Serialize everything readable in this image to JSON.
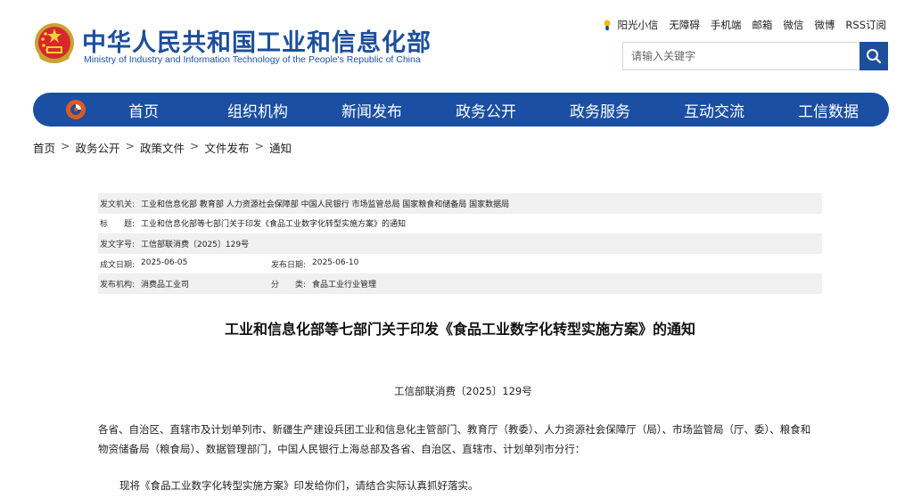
{
  "header": {
    "title_cn": "中华人民共和国工业和信息化部",
    "title_en": "Ministry of Industry and Information Technology of the People's Republic of China",
    "brand_color": "#1d4f9c",
    "top_links": [
      "阳光小信",
      "无障碍",
      "手机端",
      "邮箱",
      "微信",
      "微博",
      "RSS订阅"
    ],
    "search_placeholder": "请输入关键字"
  },
  "nav": {
    "color": "#1a4fa3",
    "items": [
      "首页",
      "组织机构",
      "新闻发布",
      "政务公开",
      "政务服务",
      "互动交流",
      "工信数据"
    ]
  },
  "breadcrumb": [
    "首页",
    "政务公开",
    "政策文件",
    "文件发布",
    "通知"
  ],
  "meta": {
    "issuer_label": "发文机关:",
    "issuer": "工业和信息化部 教育部 人力资源社会保障部 中国人民银行 市场监管总局 国家粮食和储备局 国家数据局",
    "title_label": "标　　题:",
    "title": "工业和信息化部等七部门关于印发《食品工业数字化转型实施方案》的通知",
    "doc_no_label": "发文字号:",
    "doc_no": "工信部联消费〔2025〕129号",
    "created_label": "成文日期:",
    "created": "2025-06-05",
    "published_label": "发布日期:",
    "published": "2025-06-10",
    "org_label": "发布机构:",
    "org": "消费品工业司",
    "category_label": "分　　类:",
    "category": "食品工业行业管理"
  },
  "document": {
    "title": "工业和信息化部等七部门关于印发《食品工业数字化转型实施方案》的通知",
    "number": "工信部联消费〔2025〕129号",
    "para1": "各省、自治区、直辖市及计划单列市、新疆生产建设兵团工业和信息化主管部门、教育厅（教委）、人力资源社会保障厅（局）、市场监管局（厅、委）、粮食和物资储备局（粮食局）、数据管理部门，中国人民银行上海总部及各省、自治区、直辖市、计划单列市分行：",
    "para2": "现将《食品工业数字化转型实施方案》印发给你们，请结合实际认真抓好落实。"
  }
}
